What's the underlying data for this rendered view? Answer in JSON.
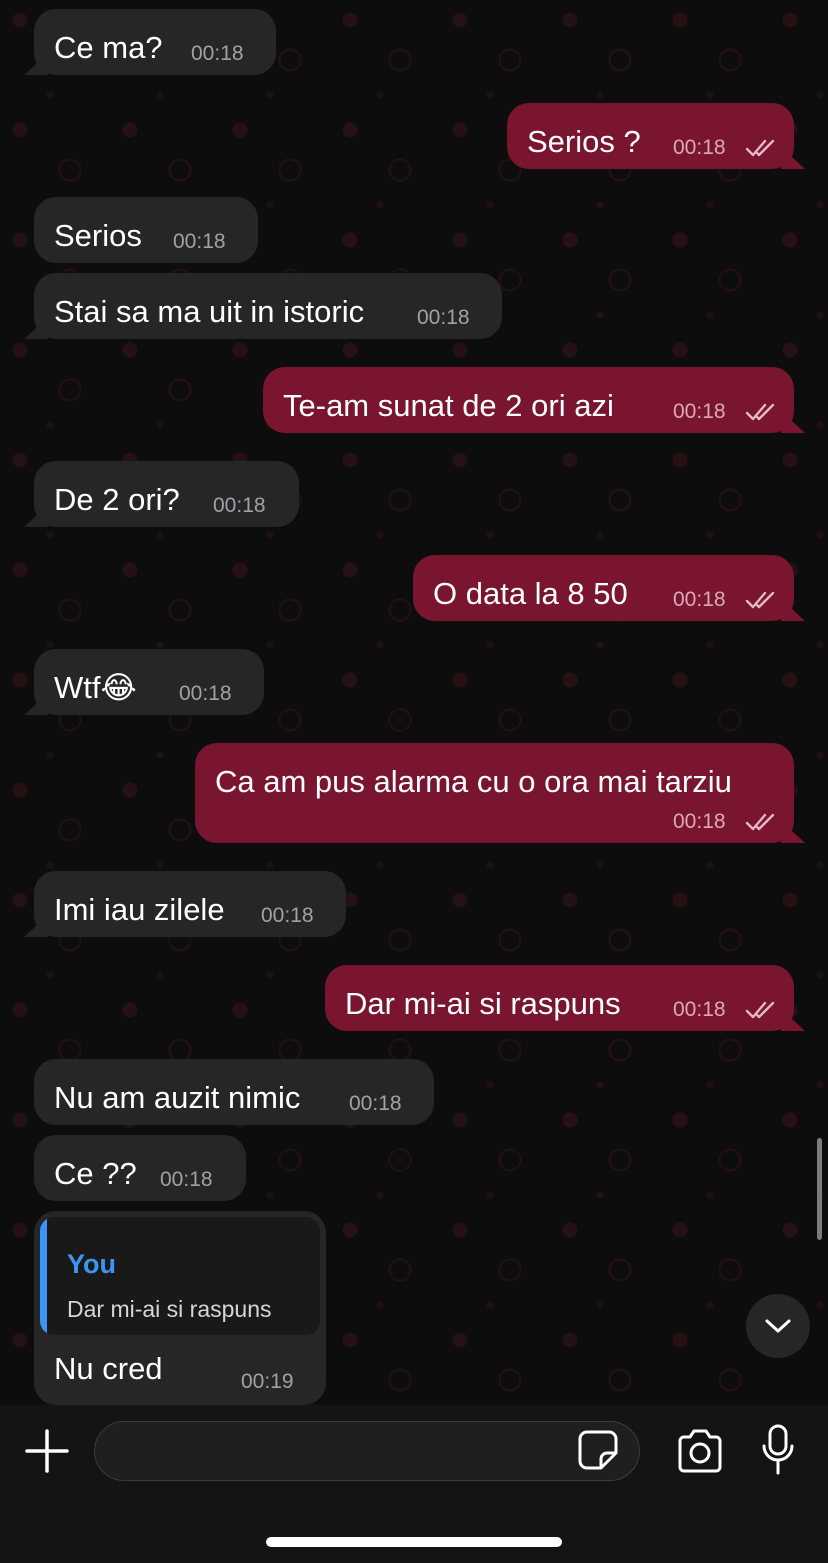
{
  "messages": [
    {
      "text": "Ce ma?",
      "time": "00:18",
      "dir": "in"
    },
    {
      "text": "Serios ?",
      "time": "00:18",
      "dir": "out"
    },
    {
      "text": "Serios",
      "time": "00:18",
      "dir": "in"
    },
    {
      "text": "Stai sa ma uit in istoric",
      "time": "00:18",
      "dir": "in"
    },
    {
      "text": "Te-am sunat de 2 ori azi",
      "time": "00:18",
      "dir": "out"
    },
    {
      "text": "De 2 ori?",
      "time": "00:18",
      "dir": "in"
    },
    {
      "text": "O data la 8 50",
      "time": "00:18",
      "dir": "out"
    },
    {
      "text": "Wtf😂",
      "time": "00:18",
      "dir": "in"
    },
    {
      "text": "Ca am pus alarma cu o ora mai tarziu",
      "time": "00:18",
      "dir": "out"
    },
    {
      "text": "Imi iau zilele",
      "time": "00:18",
      "dir": "in"
    },
    {
      "text": "Dar mi-ai si raspuns",
      "time": "00:18",
      "dir": "out"
    },
    {
      "text": "Nu am auzit nimic",
      "time": "00:18",
      "dir": "in"
    },
    {
      "text": "Ce ??",
      "time": "00:18",
      "dir": "in"
    },
    {
      "text": "Nu cred",
      "time": "00:19",
      "dir": "in",
      "reply_to": {
        "author": "You",
        "text": "Dar mi-ai si raspuns"
      }
    }
  ],
  "input": {
    "placeholder": ""
  },
  "icons": {
    "attach": "plus-icon",
    "sticker": "sticker-icon",
    "camera": "camera-icon",
    "voice": "microphone-icon",
    "scroll_down": "chevron-down-icon",
    "read_receipt": "double-check-icon"
  },
  "colors": {
    "incoming_bubble": "#262626",
    "outgoing_bubble": "#7a1530",
    "quote_accent": "#3b95f5",
    "background": "#0e0d0d"
  }
}
